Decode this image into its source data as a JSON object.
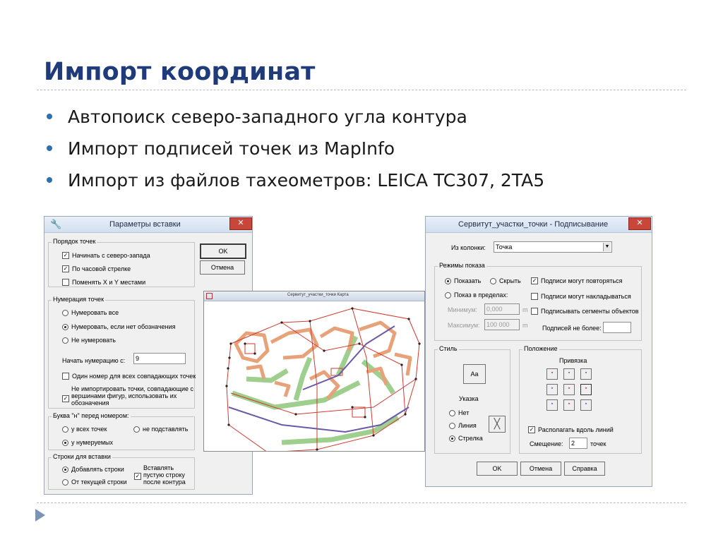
{
  "slide": {
    "title": "Импорт координат",
    "bullets": [
      "Автопоиск северо-западного угла контура",
      "Импорт подписей точек из MapInfo",
      "Импорт из файлов тахеометров: LEICA TC307, 2TA5"
    ]
  },
  "dialog1": {
    "title": "Параметры вставки",
    "close": "✕",
    "ok": "OK",
    "cancel": "Отмена",
    "order": {
      "label": "Порядок точек",
      "items": [
        "Начинать с северо-запада",
        "По часовой стрелке",
        "Поменять X и Y местами"
      ]
    },
    "numbering": {
      "label": "Нумерация точек",
      "opt1": "Нумеровать все",
      "opt2": "Нумеровать, если нет обозначения",
      "opt3": "Не нумеровать",
      "start_label": "Начать нумерацию с:",
      "start_value": "9",
      "same_number": "Один номер для всех совпадающих точек",
      "skip_line1": "Не импортировать точки, совпадающие с",
      "skip_line2": "вершинами фигур, использовать их",
      "skip_line3": "обозначения"
    },
    "letter": {
      "label": "Буква \"н\" перед номером:",
      "opt1": "у всех точек",
      "opt2": "не подставлять",
      "opt3": "у нумеруемых"
    },
    "rows": {
      "label": "Строки для вставки",
      "opt1": "Добавлять строки",
      "opt2": "От текущей строки",
      "insert_line1": "Вставлять",
      "insert_line2": "пустую строку",
      "insert_line3": "после контура"
    }
  },
  "map": {
    "title": "Сервитут_участки_точки Карта"
  },
  "dialog2": {
    "title": "Сервитут_участки_точки - Подписывание",
    "close": "✕",
    "column_label": "Из колонки:",
    "column_value": "Точка",
    "modes": {
      "label": "Режимы показа",
      "show": "Показать",
      "hide": "Скрыть",
      "range": "Показ в пределах:",
      "min_label": "Минимум:",
      "min_value": "0,000",
      "max_label": "Максимум:",
      "max_value": "100 000",
      "unit": "m",
      "repeat": "Подписи могут повторяться",
      "overlap": "Подписи могут накладываться",
      "segments": "Подписывать сегменты объектов",
      "max_labels": "Подписей не более:"
    },
    "style": {
      "label": "Стиль",
      "font_btn": "Аа",
      "pointer": "Указка",
      "none": "Нет",
      "line": "Линия",
      "arrow": "Стрелка"
    },
    "position": {
      "label": "Положение",
      "anchor": "Привязка",
      "along": "Располагать вдоль линий",
      "offset_label": "Смещение:",
      "offset_value": "2",
      "offset_unit": "точек"
    },
    "ok": "OK",
    "cancel": "Отмена",
    "help": "Справка"
  },
  "colors": {
    "title": "#1f3b7a",
    "bullet": "#2f6fb0",
    "parcel_outline": "#d23a2e",
    "building": "#e8a27a",
    "green_zone": "#9fcf8e",
    "route": "#6a5aa8",
    "close_button": "#c9473a"
  }
}
